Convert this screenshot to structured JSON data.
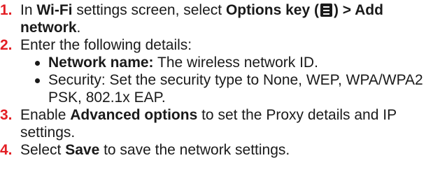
{
  "accent_color": "#e31e24",
  "steps": [
    {
      "number": "1.",
      "t1": "In ",
      "b1": "Wi-Fi",
      "t2": " settings screen, select ",
      "b2": "Options key",
      "t3": " (",
      "icon": "options-menu-icon",
      "b3": ") > Add network",
      "t4": "."
    },
    {
      "number": "2.",
      "text": "Enter the following details:",
      "bullets": [
        {
          "label": "Network name:",
          "text": " The wireless network ID."
        },
        {
          "text": "Security: Set the security type to None, WEP, WPA/WPA2 PSK, 802.1x EAP."
        }
      ]
    },
    {
      "number": "3.",
      "t1": "Enable ",
      "b1": "Advanced options",
      "t2": " to set the Proxy details and IP settings."
    },
    {
      "number": "4.",
      "t1": "Select ",
      "b1": "Save",
      "t2": " to save the network settings."
    }
  ]
}
